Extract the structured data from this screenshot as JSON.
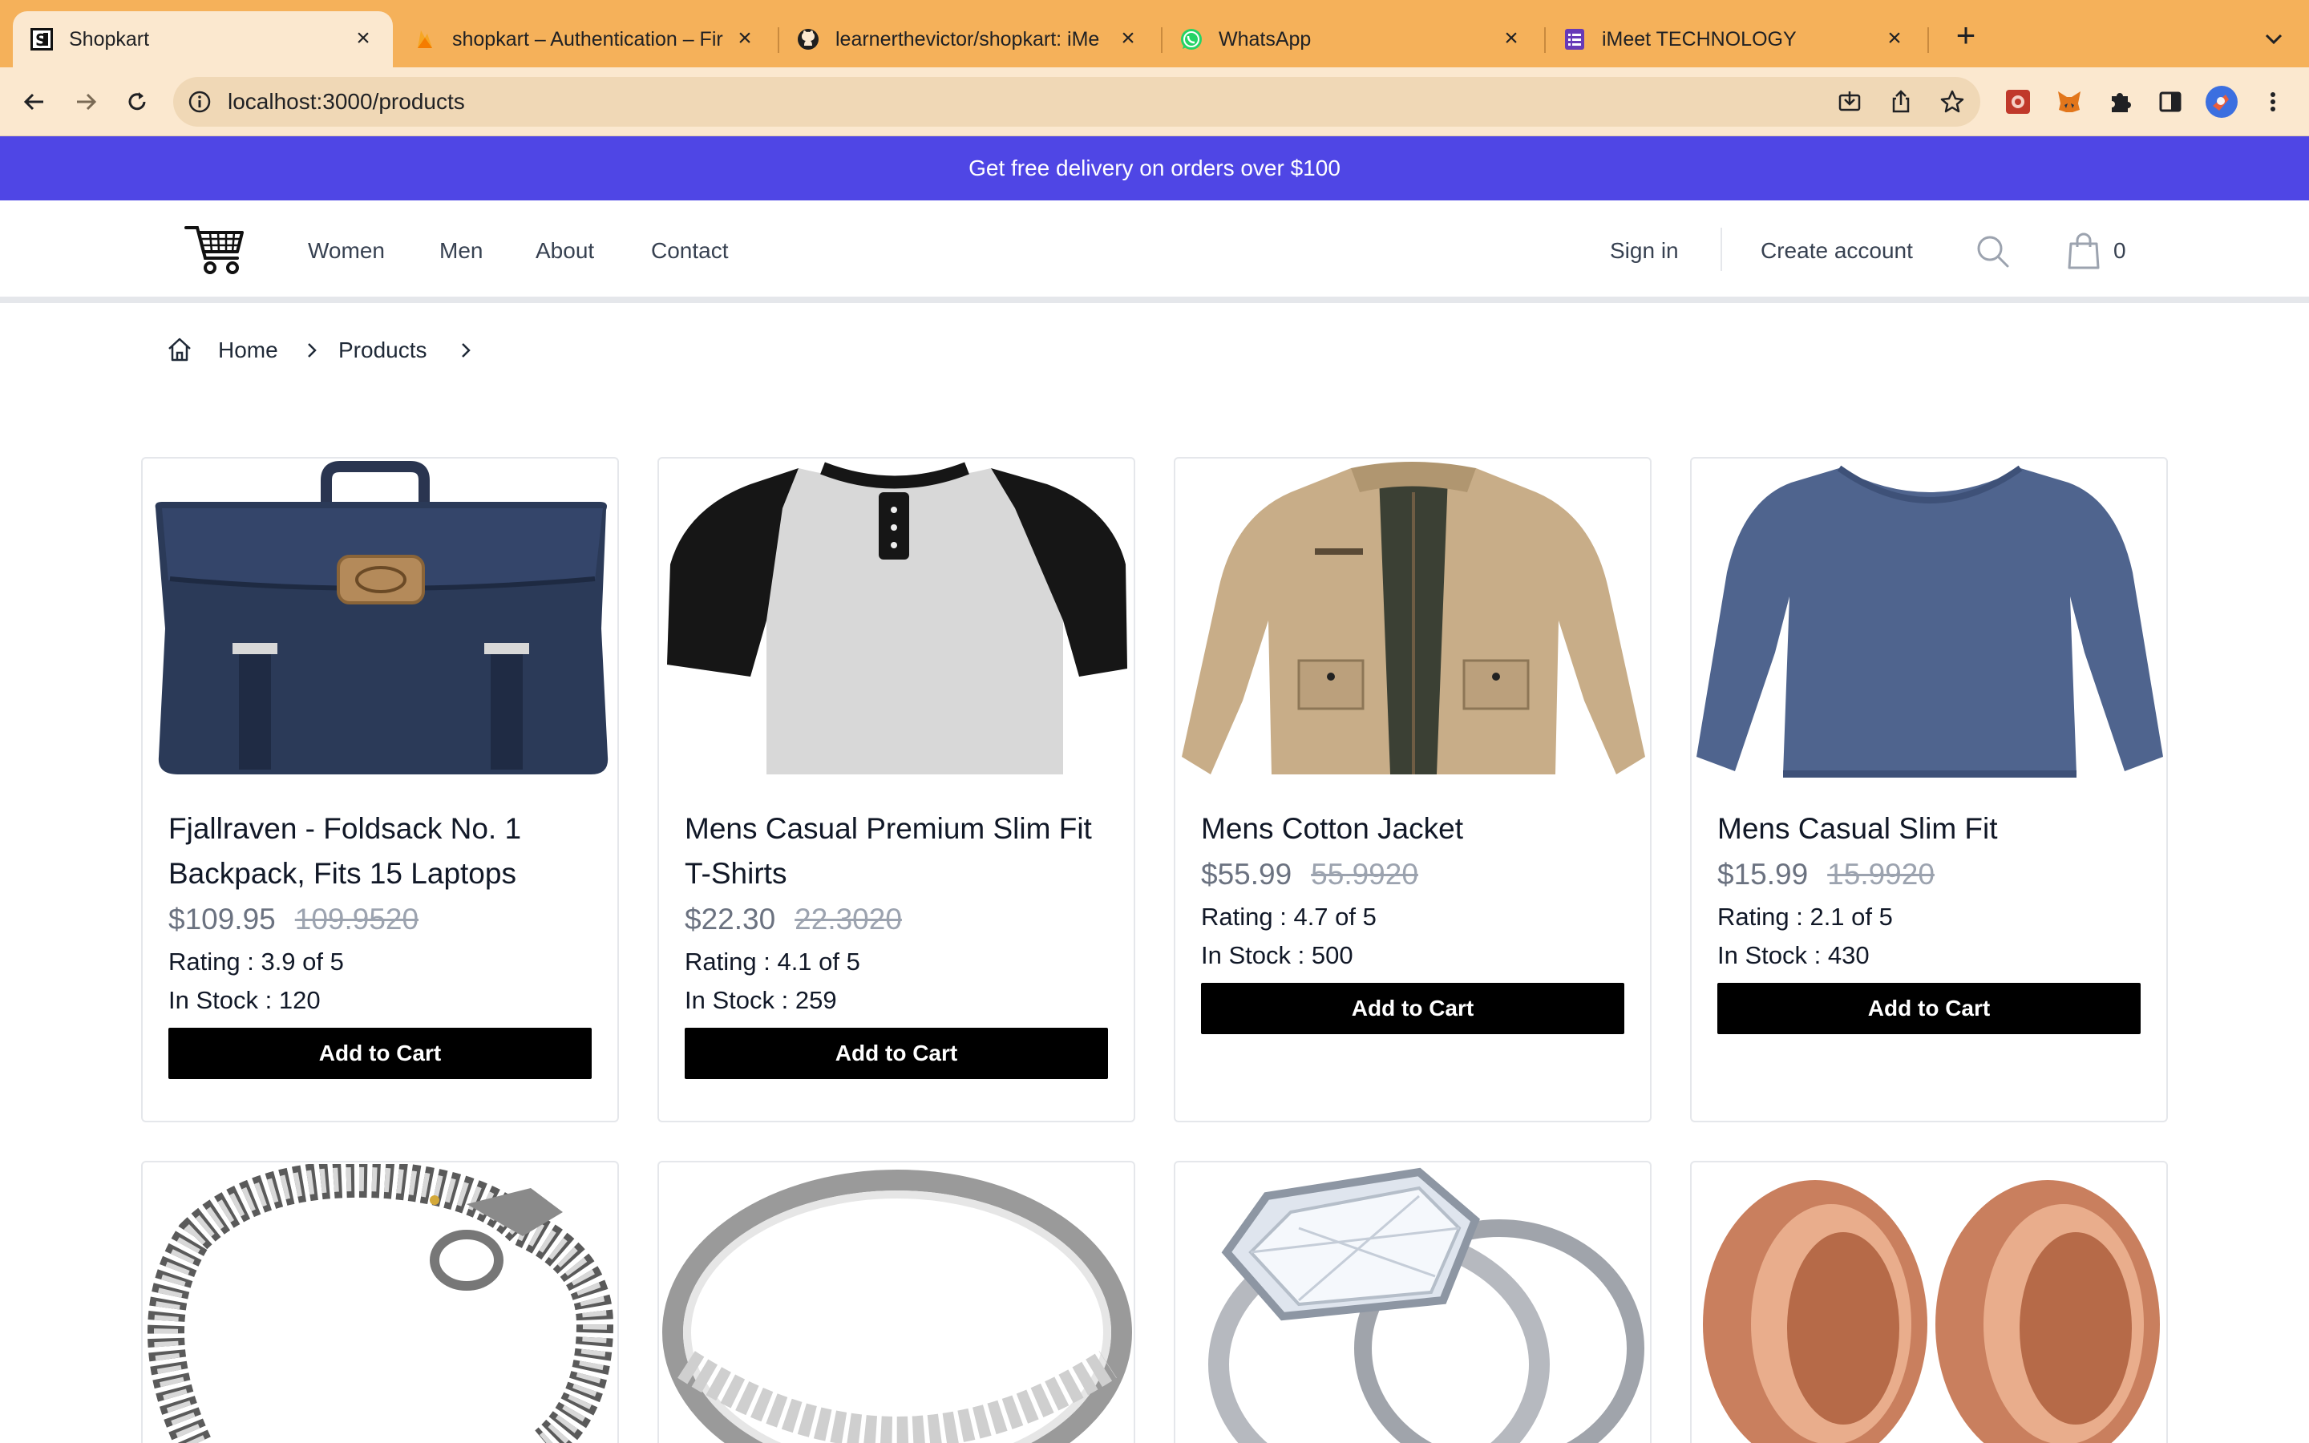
{
  "browser": {
    "tabs": [
      {
        "title": "Shopkart",
        "favicon": "shopkart-favicon",
        "active": true
      },
      {
        "title": "shopkart – Authentication – Fir",
        "favicon": "firebase-icon",
        "active": false
      },
      {
        "title": "learnerthevictor/shopkart: iMe",
        "favicon": "github-icon",
        "active": false
      },
      {
        "title": "WhatsApp",
        "favicon": "whatsapp-icon",
        "active": false
      },
      {
        "title": "iMeet TECHNOLOGY",
        "favicon": "form-icon",
        "active": false
      }
    ],
    "url": "localhost:3000/products"
  },
  "banner": {
    "text": "Get free delivery on orders over $100"
  },
  "header": {
    "nav": [
      "Women",
      "Men",
      "About",
      "Contact"
    ],
    "sign_in": "Sign in",
    "create_account": "Create account",
    "cart_count": "0"
  },
  "breadcrumb": [
    "Home",
    "Products"
  ],
  "products": [
    {
      "name": "Fjallraven - Foldsack No. 1 Backpack, Fits 15 Laptops",
      "price": "$109.95",
      "old_price": "109.9520",
      "rating": "Rating : 3.9 of 5",
      "stock": "In Stock : 120",
      "button": "Add to Cart",
      "image": "navy-backpack-image"
    },
    {
      "name": "Mens Casual Premium Slim Fit T-Shirts",
      "price": "$22.30",
      "old_price": "22.3020",
      "rating": "Rating : 4.1 of 5",
      "stock": "In Stock : 259",
      "button": "Add to Cart",
      "image": "raglan-tshirt-image"
    },
    {
      "name": "Mens Cotton Jacket",
      "price": "$55.99",
      "old_price": "55.9920",
      "rating": "Rating : 4.7 of 5",
      "stock": "In Stock : 500",
      "button": "Add to Cart",
      "image": "beige-jacket-image"
    },
    {
      "name": "Mens Casual Slim Fit",
      "price": "$15.99",
      "old_price": "15.9920",
      "rating": "Rating : 2.1 of 5",
      "stock": "In Stock : 430",
      "button": "Add to Cart",
      "image": "blue-longsleeve-image"
    }
  ],
  "products_row2": [
    {
      "image": "dragon-bracelet-image"
    },
    {
      "image": "silver-ring-image"
    },
    {
      "image": "diamond-ring-image"
    },
    {
      "image": "rose-gold-tunnel-image"
    }
  ],
  "colors": {
    "banner": "#4f46e5",
    "tabstrip": "#f5b15a",
    "button": "#000000"
  }
}
